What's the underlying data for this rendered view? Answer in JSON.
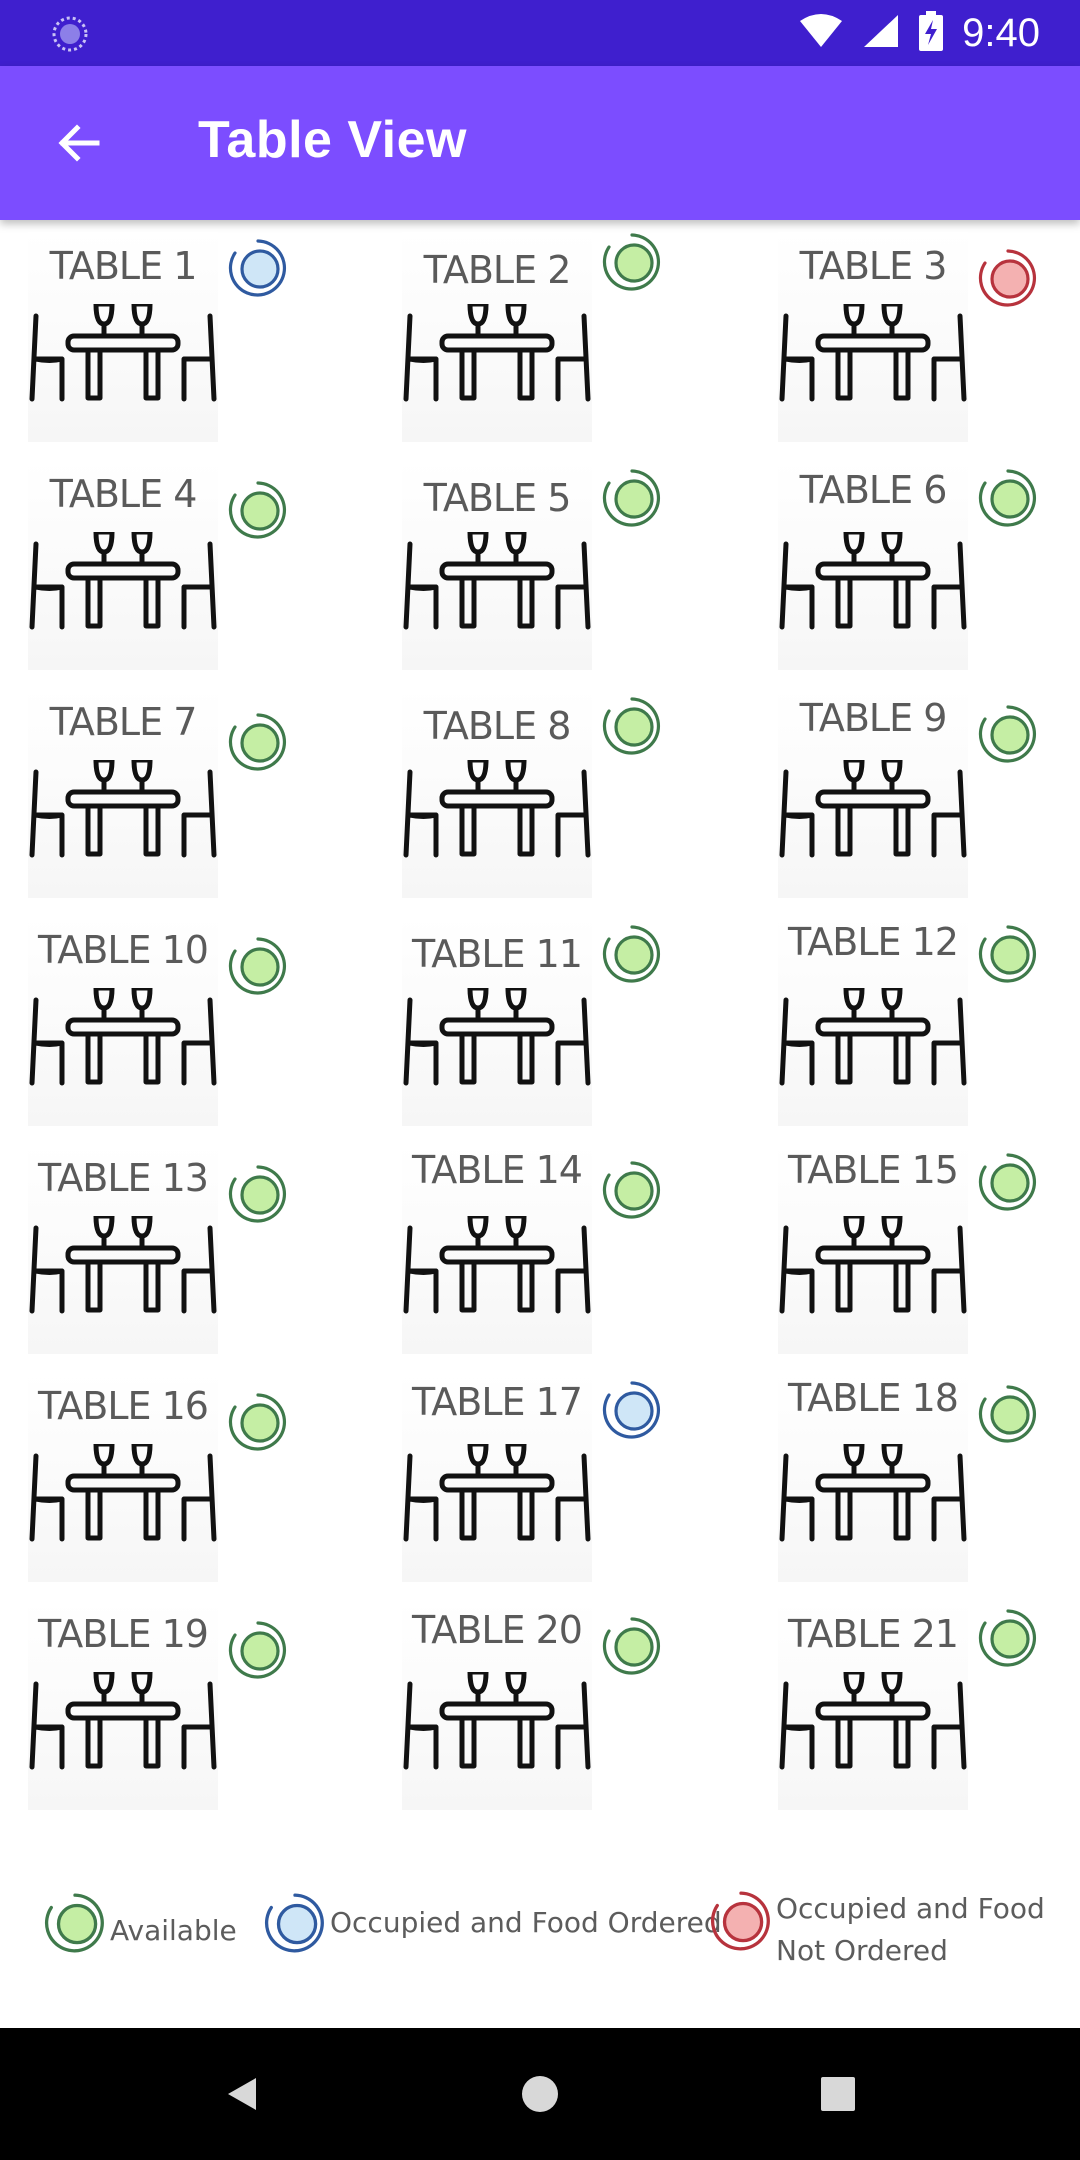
{
  "status_bar": {
    "time": "9:40",
    "left_icon": "spinner-icon",
    "icons": [
      "wifi-icon",
      "signal-icon",
      "battery-charging-icon"
    ]
  },
  "app_bar": {
    "title": "Table View",
    "back_icon": "arrow-left-icon"
  },
  "status_colors": {
    "available": {
      "ring": "#3f7a4b",
      "fill": "#c5eea4"
    },
    "occupied_ordered": {
      "ring": "#2f5aa0",
      "fill": "#cfe6f7"
    },
    "occupied_not_ordered": {
      "ring": "#b7333d",
      "fill": "#f4b1b1"
    }
  },
  "tables": [
    {
      "label": "TABLE 1",
      "status": "occupied_ordered"
    },
    {
      "label": "TABLE 2",
      "status": "available"
    },
    {
      "label": "TABLE 3",
      "status": "occupied_not_ordered"
    },
    {
      "label": "TABLE 4",
      "status": "available"
    },
    {
      "label": "TABLE 5",
      "status": "available"
    },
    {
      "label": "TABLE 6",
      "status": "available"
    },
    {
      "label": "TABLE 7",
      "status": "available"
    },
    {
      "label": "TABLE 8",
      "status": "available"
    },
    {
      "label": "TABLE 9",
      "status": "available"
    },
    {
      "label": "TABLE 10",
      "status": "available"
    },
    {
      "label": "TABLE 11",
      "status": "available"
    },
    {
      "label": "TABLE 12",
      "status": "available"
    },
    {
      "label": "TABLE 13",
      "status": "available"
    },
    {
      "label": "TABLE 14",
      "status": "available"
    },
    {
      "label": "TABLE 15",
      "status": "available"
    },
    {
      "label": "TABLE 16",
      "status": "available"
    },
    {
      "label": "TABLE 17",
      "status": "occupied_ordered"
    },
    {
      "label": "TABLE 18",
      "status": "available"
    },
    {
      "label": "TABLE 19",
      "status": "available"
    },
    {
      "label": "TABLE 20",
      "status": "available"
    },
    {
      "label": "TABLE 21",
      "status": "available"
    }
  ],
  "legend": {
    "available": "Available",
    "occupied_ordered": "Occupied and Food Ordered",
    "occupied_not_ordered_line1": "Occupied and Food",
    "occupied_not_ordered_line2": "Not Ordered"
  },
  "nav_bar": {
    "back_icon": "nav-back-triangle-icon",
    "home_icon": "nav-home-circle-icon",
    "recents_icon": "nav-recents-square-icon"
  }
}
